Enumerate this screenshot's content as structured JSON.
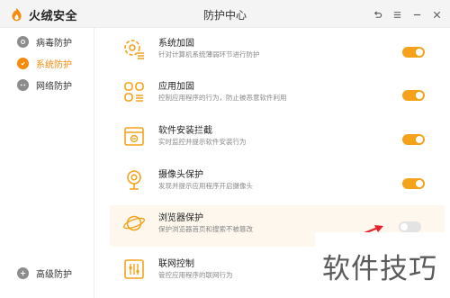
{
  "app": {
    "brand_name": "火绒安全",
    "window_title": "防护中心"
  },
  "window_controls": [
    {
      "name": "back-icon"
    },
    {
      "name": "menu-icon"
    },
    {
      "name": "minimize-icon"
    },
    {
      "name": "close-icon"
    }
  ],
  "sidebar": {
    "items": [
      {
        "label": "病毒防护",
        "icon": "virus-shield-icon",
        "active": false
      },
      {
        "label": "系统防护",
        "icon": "system-shield-icon",
        "active": true
      },
      {
        "label": "网络防护",
        "icon": "network-shield-icon",
        "active": false
      }
    ],
    "bottom_item": {
      "label": "高级防护",
      "icon": "advanced-shield-icon"
    }
  },
  "protections": [
    {
      "title": "系统加固",
      "desc": "针对计算机系统薄弱环节进行防护",
      "icon": "system-gear-icon",
      "enabled": true
    },
    {
      "title": "应用加固",
      "desc": "控制应用程序的行为，防止被恶意软件利用",
      "icon": "app-grid-icon",
      "enabled": true
    },
    {
      "title": "软件安装拦截",
      "desc": "实时监控并提示软件安装行为",
      "icon": "install-block-icon",
      "enabled": true
    },
    {
      "title": "摄像头保护",
      "desc": "发现并提示应用程序开启摄像头",
      "icon": "camera-icon",
      "enabled": true
    },
    {
      "title": "浏览器保护",
      "desc": "保护浏览器首页和搜索不被篡改",
      "icon": "browser-planet-icon",
      "enabled": false
    },
    {
      "title": "联网控制",
      "desc": "管控应用程序的联网行为",
      "icon": "network-control-icon",
      "enabled": true
    }
  ],
  "watermark": "软件技巧",
  "colors": {
    "accent": "#f58a0b",
    "toggle_on": "#f5a21b",
    "toggle_off": "#e3e3e3",
    "highlight_row": "#fdf7ee"
  }
}
